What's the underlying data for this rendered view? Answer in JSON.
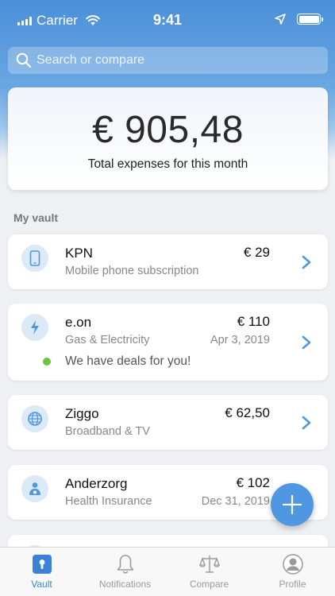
{
  "status_bar": {
    "carrier": "Carrier",
    "time": "9:41"
  },
  "search": {
    "placeholder": "Search or compare"
  },
  "summary": {
    "amount": "€ 905,48",
    "caption": "Total expenses for this month"
  },
  "vault": {
    "title": "My vault",
    "items": [
      {
        "name": "KPN",
        "description": "Mobile phone subscription",
        "amount": "€  29",
        "icon": "mobile-phone-icon"
      },
      {
        "name": "e.on",
        "description": "Gas & Electricity",
        "amount": "€  110",
        "date": "Apr 3, 2019",
        "deal": "We have deals for you!",
        "icon": "lightning-icon"
      },
      {
        "name": "Ziggo",
        "description": "Broadband & TV",
        "amount": "€  62,50",
        "icon": "globe-icon"
      },
      {
        "name": "Anderzorg",
        "description": "Health Insurance",
        "amount": "€  102",
        "date": "Dec 31, 2019",
        "icon": "doctor-icon"
      }
    ]
  },
  "tabs": [
    {
      "label": "Vault",
      "icon": "vault-lock-icon",
      "active": true
    },
    {
      "label": "Notifications",
      "icon": "bell-icon",
      "active": false
    },
    {
      "label": "Compare",
      "icon": "scales-icon",
      "active": false
    },
    {
      "label": "Profile",
      "icon": "profile-icon",
      "active": false
    }
  ],
  "colors": {
    "accent": "#3b82d6",
    "header_blue": "#4a8fd8",
    "deal_green": "#6cc43c",
    "fab": "#4f97e0"
  }
}
